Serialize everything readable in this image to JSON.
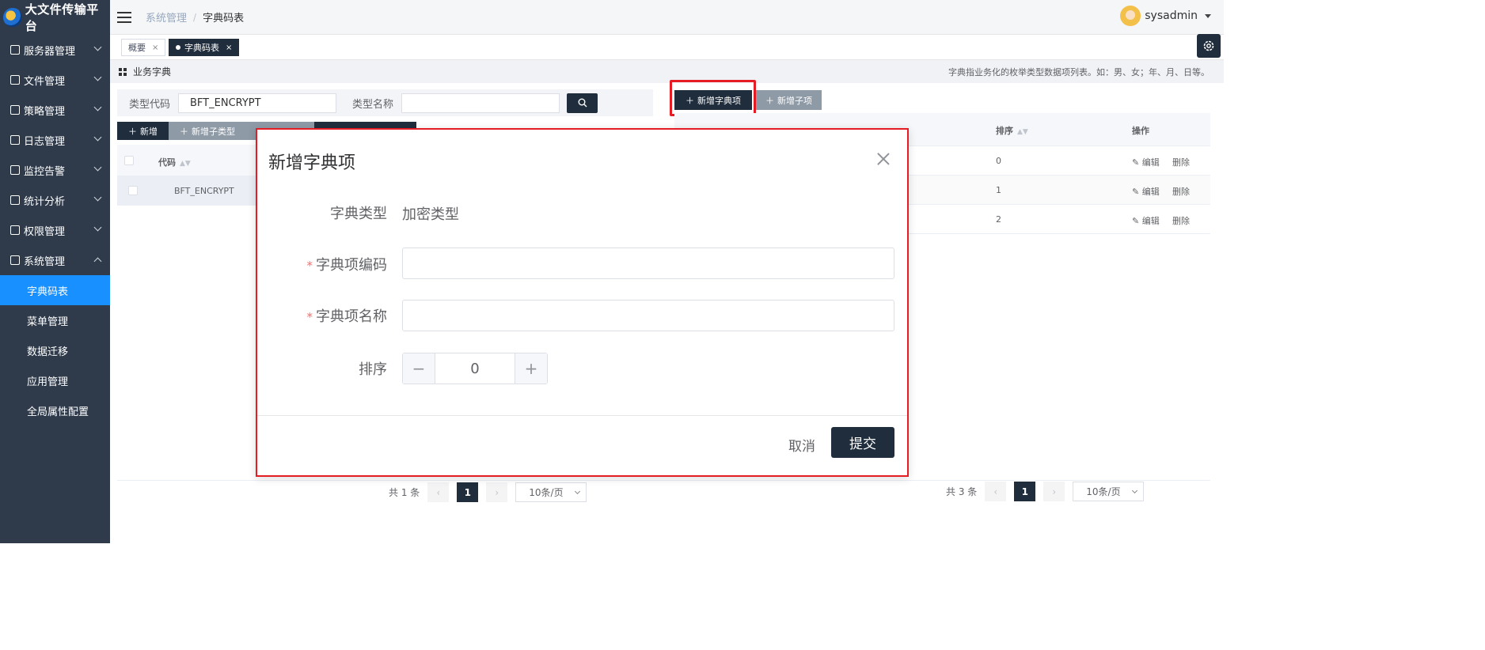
{
  "app": {
    "title": "大文件传输平台"
  },
  "sidebar": {
    "items": [
      {
        "label": "服务器管理"
      },
      {
        "label": "文件管理"
      },
      {
        "label": "策略管理"
      },
      {
        "label": "日志管理"
      },
      {
        "label": "监控告警"
      },
      {
        "label": "统计分析"
      },
      {
        "label": "权限管理"
      },
      {
        "label": "系统管理"
      }
    ],
    "sub_items": [
      {
        "label": "字典码表"
      },
      {
        "label": "菜单管理"
      },
      {
        "label": "数据迁移"
      },
      {
        "label": "应用管理"
      },
      {
        "label": "全局属性配置"
      }
    ]
  },
  "header": {
    "breadcrumb": [
      "系统管理",
      "/",
      "字典码表"
    ],
    "user": "sysadmin"
  },
  "tabs": [
    {
      "label": "概要",
      "close": "×"
    },
    {
      "label": "字典码表",
      "close": "×"
    }
  ],
  "section": {
    "title": "业务字典",
    "hint": "字典指业务化的枚举类型数据项列表。如：男、女；年、月、日等。"
  },
  "left": {
    "search": {
      "code_label": "类型代码",
      "code_value": "BFT_ENCRYPT",
      "name_label": "类型名称",
      "name_value": ""
    },
    "buttons": {
      "add": "新增",
      "add_sub_type": "新增子类型"
    },
    "columns": {
      "code": "代码"
    },
    "rows": [
      {
        "code": "BFT_ENCRYPT"
      }
    ],
    "pager": {
      "total": "共 1 条",
      "page": "1",
      "size": "10条/页"
    }
  },
  "right": {
    "buttons": {
      "add_item": "新增字典项",
      "add_sub_item": "新增子项"
    },
    "columns": {
      "sort": "排序",
      "ops": "操作"
    },
    "rows": [
      {
        "sort": "0",
        "edit": "编辑",
        "delete": "删除"
      },
      {
        "sort": "1",
        "edit": "编辑",
        "delete": "删除"
      },
      {
        "sort": "2",
        "edit": "编辑",
        "delete": "删除"
      }
    ],
    "pager": {
      "total": "共 3 条",
      "page": "1",
      "size": "10条/页"
    }
  },
  "modal": {
    "title": "新增字典项",
    "type_label": "字典类型",
    "type_value": "加密类型",
    "code_label": "字典项编码",
    "name_label": "字典项名称",
    "required_mark": "*",
    "sort_label": "排序",
    "sort_value": "0",
    "minus": "−",
    "plus": "+",
    "cancel": "取消",
    "submit": "提交"
  },
  "colors": {
    "sidebar_bg": "#2f3b4b",
    "active_menu": "#1890ff",
    "primary_dark": "#1f2d3d",
    "highlight": "#e51c23"
  },
  "icons": [
    "logo-icon",
    "menu-toggle-icon",
    "chevron-down-icon",
    "chevron-up-icon",
    "gear-icon",
    "search-icon",
    "plus-icon",
    "edit-icon",
    "close-icon",
    "grid-icon",
    "sort-icon",
    "caret-down-icon"
  ]
}
